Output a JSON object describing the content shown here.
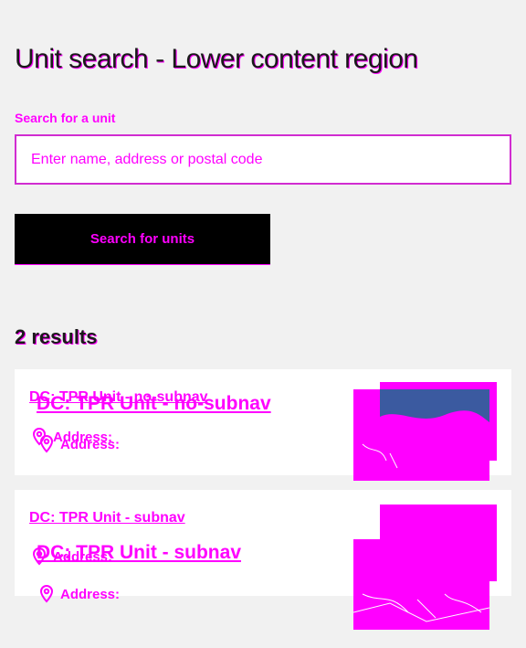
{
  "page": {
    "title": "Unit search - Lower content region"
  },
  "search": {
    "label": "Search for a unit",
    "placeholder": "Enter name, address or postal code",
    "button_label": "Search for units"
  },
  "results": {
    "count_label": "2 results",
    "items": [
      {
        "name": "DC: TPR Unit - no-subnav",
        "address_label": "Address:"
      },
      {
        "name": "DC: TPR Unit - subnav",
        "address_label": "Address:"
      }
    ]
  },
  "icons": {
    "pin": "map-pin-icon"
  },
  "colors": {
    "accent": "#ff00ff",
    "button_bg": "#000000",
    "page_bg": "#f1f1f1"
  }
}
